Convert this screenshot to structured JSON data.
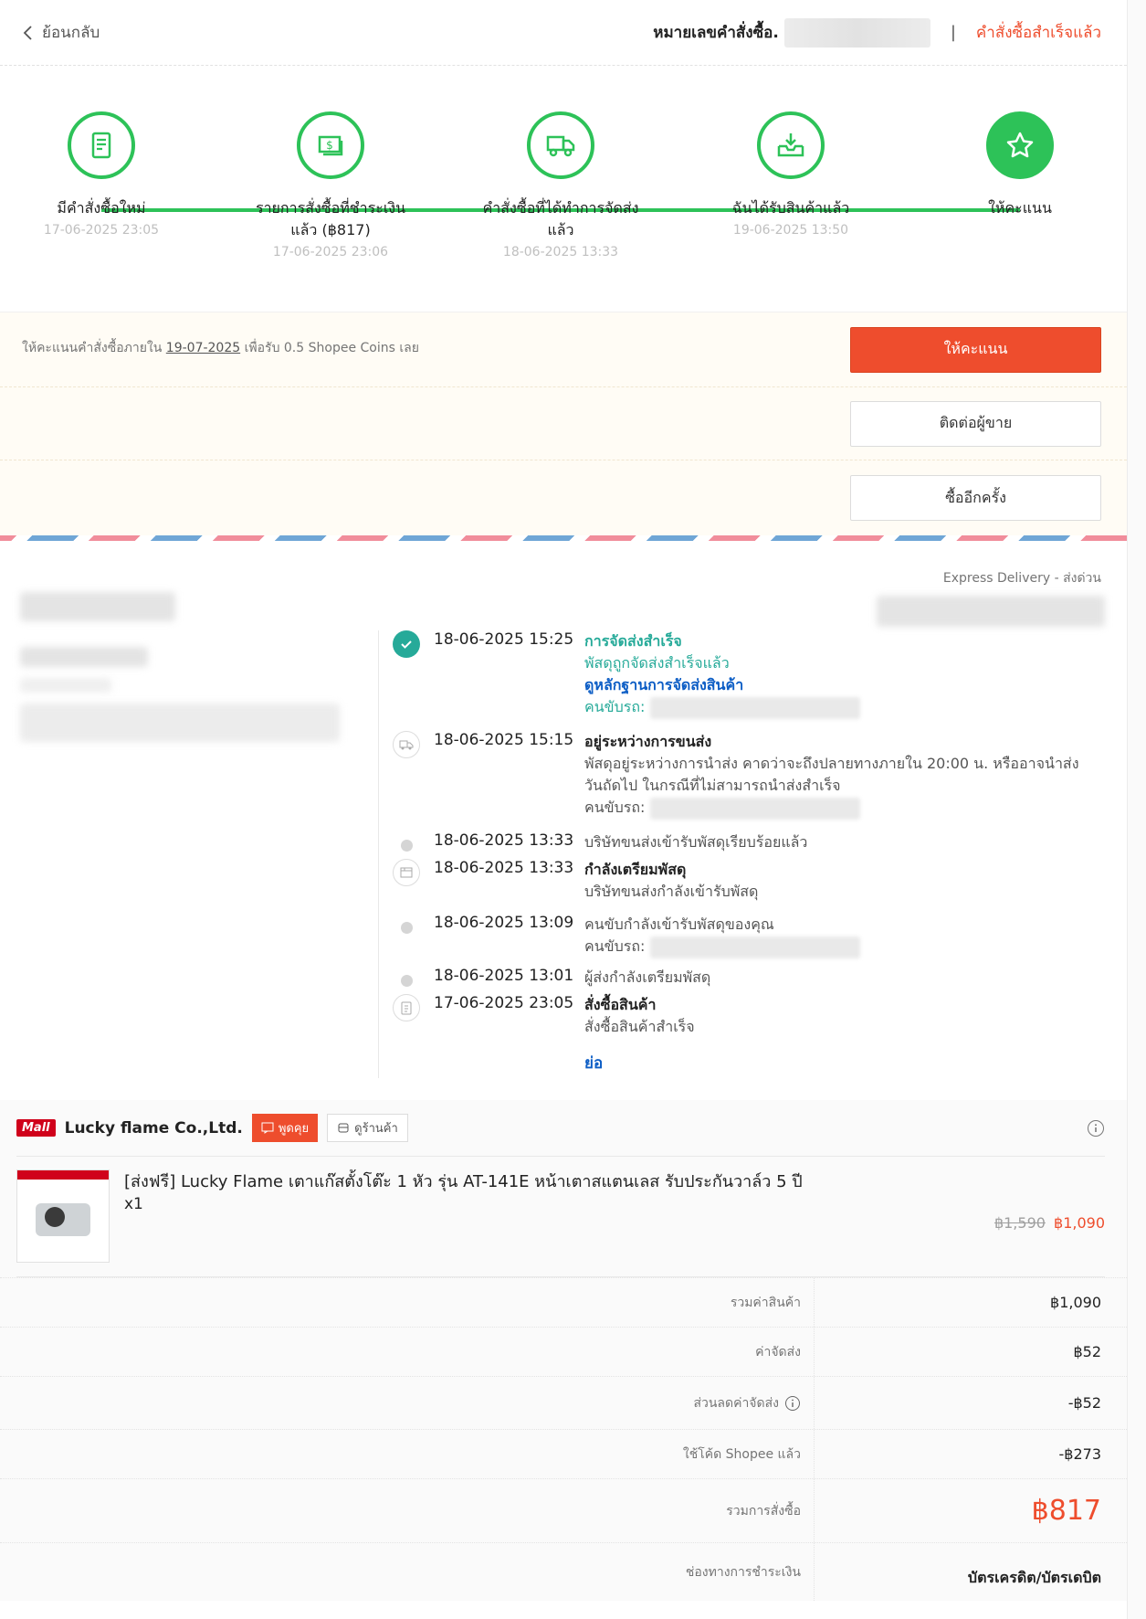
{
  "header": {
    "back_label": "ย้อนกลับ",
    "order_no_label": "หมายเลขคำสั่งซื้อ.",
    "separator": "|",
    "status": "คำสั่งซื้อสำเร็จแล้ว"
  },
  "steps": [
    {
      "label": "มีคำสั่งซื้อใหม่",
      "date": "17-06-2025 23:05",
      "icon": "receipt-icon"
    },
    {
      "label": "รายการสั่งซื้อที่ชำระเงินแล้ว (฿817)",
      "date": "17-06-2025 23:06",
      "icon": "money-icon"
    },
    {
      "label": "คำสั่งซื้อที่ได้ทำการจัดส่งแล้ว",
      "date": "18-06-2025 13:33",
      "icon": "truck-icon"
    },
    {
      "label": "ฉันได้รับสินค้าแล้ว",
      "date": "19-06-2025 13:50",
      "icon": "inbox-download-icon"
    },
    {
      "label": "ให้คะแนน",
      "date": "",
      "icon": "star-icon"
    }
  ],
  "actions": {
    "note_prefix": "ให้คะแนนคำสั่งซื้อภายใน",
    "note_date": "19-07-2025",
    "note_suffix": "เพื่อรับ 0.5 Shopee Coins เลย",
    "rate_button": "ให้คะแนน",
    "contact_button": "ติดต่อผู้ขาย",
    "rebuy_button": "ซื้ออีกครั้ง"
  },
  "shipping": {
    "service": "Express Delivery - ส่งด่วน",
    "collapse": "ย่อ",
    "events": [
      {
        "time": "18-06-2025 15:25",
        "title": "การจัดส่งสำเร็จ",
        "lines": [
          "พัสดุถูกจัดส่งสำเร็จแล้ว",
          "ดูหลักฐานการจัดส่งสินค้า",
          "คนขับรถ:"
        ]
      },
      {
        "time": "18-06-2025 15:15",
        "title": "อยู่ระหว่างการขนส่ง",
        "lines": [
          "พัสดุอยู่ระหว่างการนำส่ง คาดว่าจะถึงปลายทางภายใน 20:00 น. หรืออาจนำส่งวันถัดไป ในกรณีที่ไม่สามารถนำส่งสำเร็จ",
          "คนขับรถ:"
        ]
      },
      {
        "time": "18-06-2025 13:33",
        "title": "",
        "lines": [
          "บริษัทขนส่งเข้ารับพัสดุเรียบร้อยแล้ว"
        ]
      },
      {
        "time": "18-06-2025 13:33",
        "title": "กำลังเตรียมพัสดุ",
        "lines": [
          "บริษัทขนส่งกำลังเข้ารับพัสดุ"
        ]
      },
      {
        "time": "18-06-2025 13:09",
        "title": "",
        "lines": [
          "คนขับกำลังเข้ารับพัสดุของคุณ",
          "คนขับรถ:"
        ]
      },
      {
        "time": "18-06-2025 13:01",
        "title": "",
        "lines": [
          "ผู้ส่งกำลังเตรียมพัสดุ"
        ]
      },
      {
        "time": "17-06-2025 23:05",
        "title": "สั่งซื้อสินค้า",
        "lines": [
          "สั่งซื้อสินค้าสำเร็จ"
        ]
      }
    ]
  },
  "shop": {
    "mall_badge": "Mall",
    "name": "Lucky flame Co.,Ltd.",
    "chat_button": "พูดคุย",
    "view_shop_button": "ดูร้านค้า"
  },
  "product": {
    "name": "[ส่งฟรี] Lucky Flame เตาแก๊สตั้งโต๊ะ 1 หัว รุ่น AT-141E หน้าเตาสแตนเลส รับประกันวาล์ว 5 ปี",
    "qty": "x1",
    "price_old": "฿1,590",
    "price_new": "฿1,090"
  },
  "summary": [
    {
      "label": "รวมค่าสินค้า",
      "value": "฿1,090"
    },
    {
      "label": "ค่าจัดส่ง",
      "value": "฿52"
    },
    {
      "label": "ส่วนลดค่าจัดส่ง",
      "value": "-฿52"
    },
    {
      "label": "ใช้โค้ด Shopee แล้ว",
      "value": "-฿273"
    },
    {
      "label": "รวมการสั่งซื้อ",
      "value": "฿817"
    },
    {
      "label": "ช่องทางการชำระเงิน",
      "value": "บัตรเครดิต/บัตรเดบิต"
    }
  ],
  "colors": {
    "accent": "#ee4d2d",
    "success": "#2dc258",
    "teal": "#26aa99",
    "link": "#0c5dc5"
  }
}
